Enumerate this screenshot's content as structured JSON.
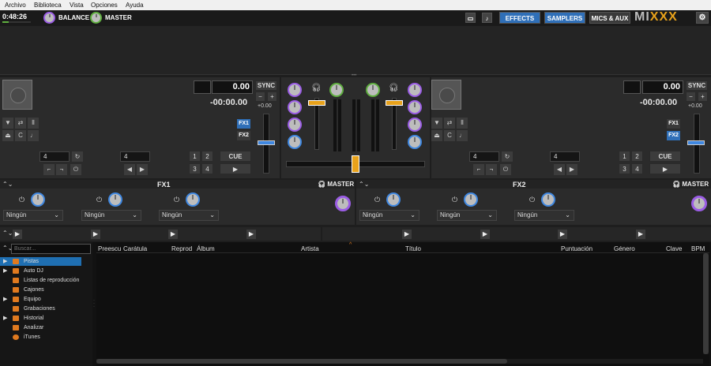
{
  "menubar": {
    "items": [
      "Archivo",
      "Biblioteca",
      "Vista",
      "Opciones",
      "Ayuda"
    ]
  },
  "topbar": {
    "clock": "0:48:26",
    "balance_label": "BALANCE",
    "master_label": "MASTER",
    "effects_label": "EFFECTS",
    "samplers_label": "SAMPLERS",
    "mics_label": "MICS & AUX",
    "logo": "MIXXX"
  },
  "deck1": {
    "rate": "0.00",
    "time": "-00:00.00",
    "sync": "SYNC",
    "minus": "−",
    "plus": "+",
    "rate_range": "+0.00",
    "fx1": "FX1",
    "fx2": "FX2",
    "beatloop": "4",
    "beatjump": "4",
    "hc1": "1",
    "hc2": "2",
    "hc3": "3",
    "hc4": "4",
    "cue": "CUE"
  },
  "deck2": {
    "rate": "0.00",
    "time": "-00:00.00",
    "sync": "SYNC",
    "minus": "−",
    "plus": "+",
    "rate_range": "+0.00",
    "fx1": "FX1",
    "fx2": "FX2",
    "beatloop": "4",
    "beatjump": "4",
    "hc1": "1",
    "hc2": "2",
    "hc3": "3",
    "hc4": "4",
    "cue": "CUE"
  },
  "fx1": {
    "title": "FX1",
    "master": "MASTER",
    "slots": [
      "Ningún",
      "Ningún",
      "Ningún"
    ]
  },
  "fx2": {
    "title": "FX2",
    "master": "MASTER",
    "slots": [
      "Ningún",
      "Ningún",
      "Ningún"
    ]
  },
  "library": {
    "search_placeholder": "Buscar...",
    "sidebar": [
      {
        "label": "Pistas",
        "expand": "▶",
        "selected": true
      },
      {
        "label": "Auto DJ",
        "expand": "▶"
      },
      {
        "label": "Listas de reproducción",
        "expand": ""
      },
      {
        "label": "Cajones",
        "expand": ""
      },
      {
        "label": "Equipo",
        "expand": "▶"
      },
      {
        "label": "Grabaciones",
        "expand": ""
      },
      {
        "label": "Historial",
        "expand": "▶"
      },
      {
        "label": "Analizar",
        "expand": ""
      },
      {
        "label": "iTunes",
        "expand": ""
      }
    ],
    "columns": {
      "preview": "Preescu",
      "cover": "Carátula",
      "played": "Reprod",
      "album": "Álbum",
      "artist": "Artista",
      "title": "Título",
      "rating": "Puntuación",
      "genre": "Género",
      "key": "Clave",
      "bpm": "BPM"
    },
    "sort_indicator": "^"
  },
  "colors": {
    "accent_blue": "#3f87e0",
    "slider_orange": "#e8a21b",
    "selected_row": "#1f6fb2"
  }
}
